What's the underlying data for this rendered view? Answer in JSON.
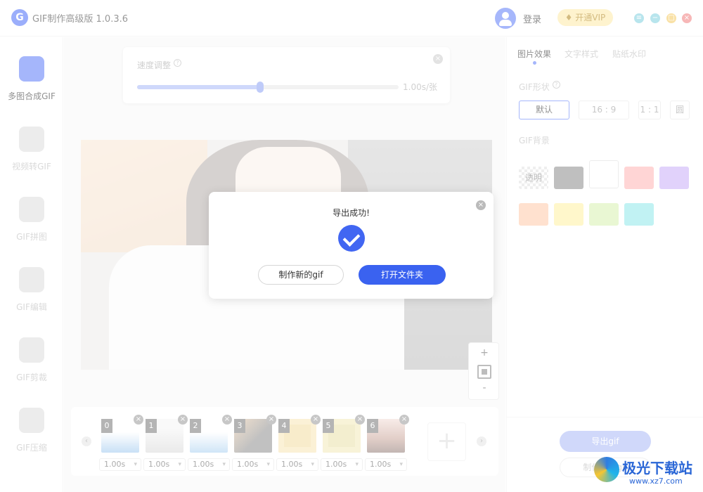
{
  "app": {
    "title": "GIF制作高级版 1.0.3.6",
    "login": "登录",
    "vip": "开通VIP"
  },
  "colors": {
    "accent": "#3a62f0",
    "vip_bg": "#fde9a6",
    "win_min": "#7fd0de",
    "win_max": "#f4c95d",
    "win_close": "#f07c7c",
    "win_skin": "#7fd0de"
  },
  "sidebar": {
    "items": [
      {
        "label": "多图合成GIF",
        "icon": "images-icon",
        "active": true
      },
      {
        "label": "视频转GIF",
        "icon": "video-icon",
        "active": false
      },
      {
        "label": "GIF拼图",
        "icon": "puzzle-icon",
        "active": false
      },
      {
        "label": "GIF编辑",
        "icon": "edit-icon",
        "active": false
      },
      {
        "label": "GIF剪裁",
        "icon": "crop-icon",
        "active": false
      },
      {
        "label": "GIF压缩",
        "icon": "compress-icon",
        "active": false
      }
    ]
  },
  "speed": {
    "label": "速度调整",
    "value": "1.00s/张",
    "help": "?",
    "level": 0.47
  },
  "zoom": {
    "plus": "+",
    "minus": "-"
  },
  "frames": [
    {
      "index": "0",
      "duration": "1.00s"
    },
    {
      "index": "1",
      "duration": "1.00s"
    },
    {
      "index": "2",
      "duration": "1.00s"
    },
    {
      "index": "3",
      "duration": "1.00s"
    },
    {
      "index": "4",
      "duration": "1.00s"
    },
    {
      "index": "5",
      "duration": "1.00s"
    },
    {
      "index": "6",
      "duration": "1.00s"
    }
  ],
  "add_frame": "+",
  "right_panel": {
    "tabs": [
      {
        "label": "图片效果",
        "active": true
      },
      {
        "label": "文字样式",
        "active": false
      },
      {
        "label": "贴纸水印",
        "active": false
      }
    ],
    "shape_heading": "GIF形状",
    "shapes": [
      "默认",
      "16 : 9",
      "1 : 1",
      "圆"
    ],
    "bg_heading": "GIF背景",
    "transparent_label": "透明",
    "bg_colors": [
      "#8a8a8a",
      "#ffffff",
      "#ffb3b3",
      "#c9aef7",
      "#ffc8a8",
      "#fff0a0",
      "#d7f0b0",
      "#8ee8ea"
    ],
    "export": "导出gif",
    "make_new": "制作新的gif"
  },
  "modal": {
    "title": "导出成功!",
    "btn_new": "制作新的gif",
    "btn_open": "打开文件夹"
  },
  "watermark": {
    "name": "极光下载站",
    "url": "www.xz7.com"
  }
}
